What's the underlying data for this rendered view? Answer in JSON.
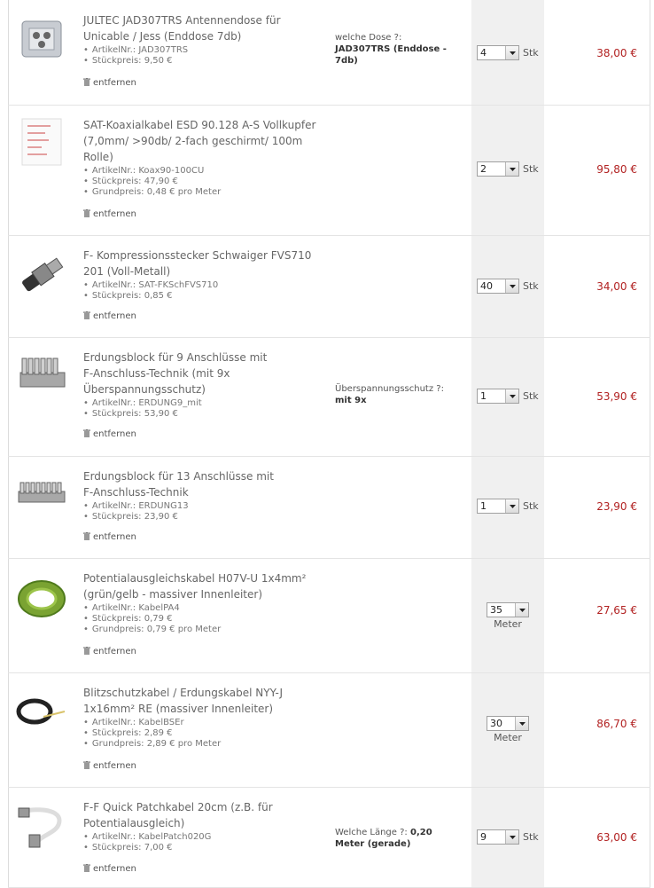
{
  "remove_label": "entfernen",
  "bullet": "•",
  "colors": {
    "price": "#b22222",
    "qty_column": "#f0f0f0"
  },
  "items": [
    {
      "name_lines": [
        "JULTEC JAD307TRS Antennendose für",
        "Unicable / Jess (Enddose 7db)"
      ],
      "attrs": [
        "ArtikelNr.: JAD307TRS",
        "Stückpreis: 9,50 €"
      ],
      "option_label": "welche Dose ?:",
      "option_value_lines": [
        "JAD307TRS (Enddose -",
        "7db)"
      ],
      "qty": "4",
      "unit": "Stk",
      "price": "38,00 €",
      "image_icon": "antenna-socket-icon"
    },
    {
      "name_lines": [
        "SAT-Koaxialkabel ESD 90.128 A-S Vollkupfer",
        "(7,0mm/ >90db/ 2-fach geschirmt/ 100m",
        "Rolle)"
      ],
      "attrs": [
        "ArtikelNr.: Koax90-100CU",
        "Stückpreis: 47,90 €",
        "Grundpreis: 0,48 € pro Meter"
      ],
      "option_label": "",
      "option_value_lines": [],
      "qty": "2",
      "unit": "Stk",
      "price": "95,80 €",
      "image_icon": "cable-diagram-icon"
    },
    {
      "name_lines": [
        "F- Kompressionsstecker Schwaiger FVS710",
        "201 (Voll-Metall)"
      ],
      "attrs": [
        "ArtikelNr.: SAT-FKSchFVS710",
        "Stückpreis: 0,85 €"
      ],
      "option_label": "",
      "option_value_lines": [],
      "qty": "40",
      "unit": "Stk",
      "price": "34,00 €",
      "image_icon": "connector-icon"
    },
    {
      "name_lines": [
        "Erdungsblock für 9 Anschlüsse mit",
        "F-Anschluss-Technik (mit 9x",
        "Überspannungsschutz)"
      ],
      "attrs": [
        "ArtikelNr.: ERDUNG9_mit",
        "Stückpreis: 53,90 €"
      ],
      "option_label": "Überspannungsschutz ?:",
      "option_value_lines": [
        "mit 9x"
      ],
      "qty": "1",
      "unit": "Stk",
      "price": "53,90 €",
      "image_icon": "grounding-block-icon"
    },
    {
      "name_lines": [
        "Erdungsblock für 13 Anschlüsse mit",
        "F-Anschluss-Technik"
      ],
      "attrs": [
        "ArtikelNr.: ERDUNG13",
        "Stückpreis: 23,90 €"
      ],
      "option_label": "",
      "option_value_lines": [],
      "qty": "1",
      "unit": "Stk",
      "price": "23,90 €",
      "image_icon": "grounding-block-13-icon"
    },
    {
      "name_lines": [
        "Potentialausgleichskabel H07V-U 1x4mm²",
        "(grün/gelb - massiver Innenleiter)"
      ],
      "attrs": [
        "ArtikelNr.: KabelPA4",
        "Stückpreis: 0,79 €",
        "Grundpreis: 0,79 € pro Meter"
      ],
      "option_label": "",
      "option_value_lines": [],
      "qty": "35",
      "unit": "Meter",
      "price": "27,65 €",
      "image_icon": "green-cable-coil-icon"
    },
    {
      "name_lines": [
        "Blitzschutzkabel / Erdungskabel NYY-J",
        "1x16mm² RE (massiver Innenleiter)"
      ],
      "attrs": [
        "ArtikelNr.: KabelBSEr",
        "Stückpreis: 2,89 €",
        "Grundpreis: 2,89 € pro Meter"
      ],
      "option_label": "",
      "option_value_lines": [],
      "qty": "30",
      "unit": "Meter",
      "price": "86,70 €",
      "image_icon": "black-cable-coil-icon"
    },
    {
      "name_lines": [
        "F-F Quick Patchkabel 20cm (z.B. für",
        "Potentialausgleich)"
      ],
      "attrs": [
        "ArtikelNr.: KabelPatch020G",
        "Stückpreis: 7,00 €"
      ],
      "option_label": "Welche Länge ?:",
      "option_label_value": "0,20",
      "option_value_lines": [
        "Meter (gerade)"
      ],
      "qty": "9",
      "unit": "Stk",
      "price": "63,00 €",
      "image_icon": "patch-cable-icon"
    }
  ]
}
